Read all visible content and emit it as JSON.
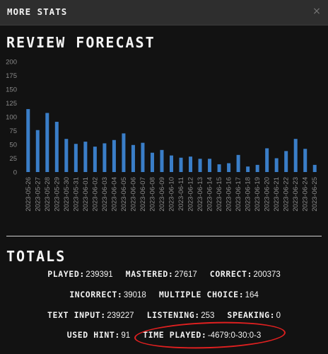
{
  "header": {
    "title": "MORE STATS",
    "close_label": "×"
  },
  "forecast": {
    "title": "REVIEW FORECAST"
  },
  "chart_data": {
    "type": "bar",
    "categories": [
      "2023-05-26",
      "2023-05-27",
      "2023-05-28",
      "2023-05-29",
      "2023-05-30",
      "2023-05-31",
      "2023-06-01",
      "2023-06-02",
      "2023-06-03",
      "2023-06-04",
      "2023-06-05",
      "2023-06-06",
      "2023-06-07",
      "2023-06-08",
      "2023-06-09",
      "2023-06-10",
      "2023-06-11",
      "2023-06-12",
      "2023-06-13",
      "2023-06-14",
      "2023-06-15",
      "2023-06-16",
      "2023-06-17",
      "2023-06-18",
      "2023-06-19",
      "2023-06-20",
      "2023-06-21",
      "2023-06-22",
      "2023-06-23",
      "2023-06-24",
      "2023-06-25"
    ],
    "values": [
      114,
      76,
      107,
      91,
      60,
      51,
      55,
      46,
      52,
      58,
      70,
      49,
      53,
      35,
      40,
      30,
      26,
      28,
      24,
      24,
      14,
      16,
      31,
      10,
      13,
      43,
      25,
      38,
      60,
      42,
      13
    ],
    "ylim": [
      0,
      200
    ],
    "yticks": [
      0,
      25,
      50,
      75,
      100,
      125,
      150,
      175,
      200
    ],
    "grid": false,
    "bar_color": "#3a7ec8"
  },
  "totals": {
    "title": "TOTALS",
    "rows": [
      [
        {
          "label": "PLAYED",
          "value": "239391"
        },
        {
          "label": "MASTERED",
          "value": "27617"
        },
        {
          "label": "CORRECT",
          "value": "200373"
        }
      ],
      [
        {
          "label": "INCORRECT",
          "value": "39018"
        },
        {
          "label": "MULTIPLE CHOICE",
          "value": "164"
        }
      ],
      [
        {
          "label": "TEXT INPUT",
          "value": "239227"
        },
        {
          "label": "LISTENING",
          "value": "253"
        },
        {
          "label": "SPEAKING",
          "value": "0"
        }
      ],
      [
        {
          "label": "USED HINT",
          "value": "91"
        },
        {
          "label": "TIME PLAYED",
          "value": "-4679:0-30:0-3"
        }
      ]
    ]
  },
  "colors": {
    "annotation_circle": "#e02020",
    "background": "#121212",
    "header": "#2e2e2e"
  }
}
